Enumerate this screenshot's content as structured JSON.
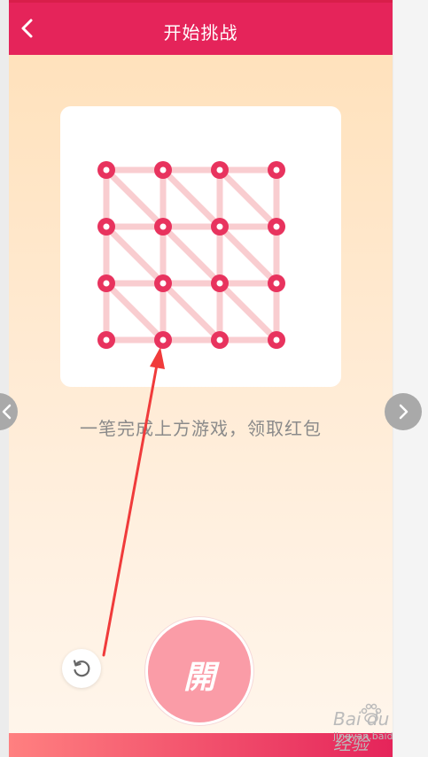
{
  "header": {
    "title": "开始挑战",
    "back_icon": "chevron-left-icon"
  },
  "puzzle": {
    "rows": 4,
    "cols": 4,
    "dot_color": "#e8335e",
    "line_color": "#f9cdd0"
  },
  "instruction": "一笔完成上方游戏，领取红包",
  "open_button": {
    "label": "開"
  },
  "refresh_icon": "refresh-icon",
  "nav": {
    "prev_icon": "chevron-left-icon",
    "next_icon": "chevron-right-icon"
  },
  "annotation_color": "#f03b3b",
  "colors": {
    "header": "#e5245a",
    "open_button": "#fa9ca7"
  },
  "watermark": {
    "brand": "Bai du 经验",
    "url": "jingyan.baidu.com"
  }
}
